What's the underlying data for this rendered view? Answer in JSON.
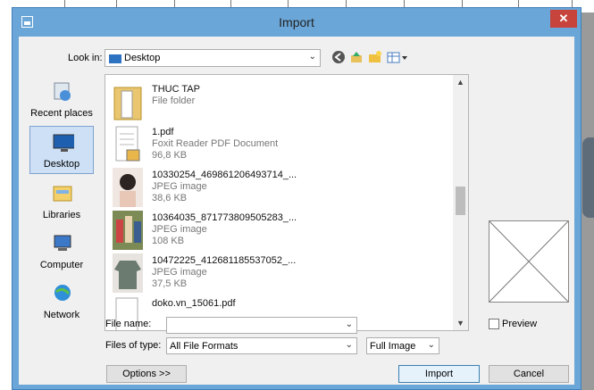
{
  "window": {
    "title": "Import",
    "close_glyph": "✕"
  },
  "look_in": {
    "label": "Look in:",
    "value": "Desktop"
  },
  "toolbar": {
    "icons": [
      "back-icon",
      "up-folder-icon",
      "new-folder-icon",
      "view-menu-icon"
    ]
  },
  "places": [
    {
      "label": "Recent places",
      "icon": "recent-places-icon",
      "selected": false
    },
    {
      "label": "Desktop",
      "icon": "desktop-icon",
      "selected": true
    },
    {
      "label": "Libraries",
      "icon": "libraries-icon",
      "selected": false
    },
    {
      "label": "Computer",
      "icon": "computer-icon",
      "selected": false
    },
    {
      "label": "Network",
      "icon": "network-icon",
      "selected": false
    }
  ],
  "files": [
    {
      "name": "THUC TAP",
      "type": "File folder",
      "size": ""
    },
    {
      "name": "1.pdf",
      "type": "Foxit Reader PDF Document",
      "size": "96,8 KB"
    },
    {
      "name": "10330254_469861206493714_...",
      "type": "JPEG image",
      "size": "38,6 KB"
    },
    {
      "name": "10364035_871773809505283_...",
      "type": "JPEG image",
      "size": "108 KB"
    },
    {
      "name": "10472225_412681185537052_...",
      "type": "JPEG image",
      "size": "37,5 KB"
    },
    {
      "name": "doko.vn_15061.pdf",
      "type": "",
      "size": ""
    }
  ],
  "form": {
    "file_name_label": "File name:",
    "file_name_value": "",
    "files_of_type_label": "Files of type:",
    "files_of_type_value": "All File Formats",
    "mode_value": "Full Image",
    "preview_label": "Preview"
  },
  "buttons": {
    "options": "Options >>",
    "import": "Import",
    "cancel": "Cancel"
  },
  "colors": {
    "title_bar": "#6aa6d8",
    "close": "#c7443c",
    "selection": "#cde0f5"
  }
}
